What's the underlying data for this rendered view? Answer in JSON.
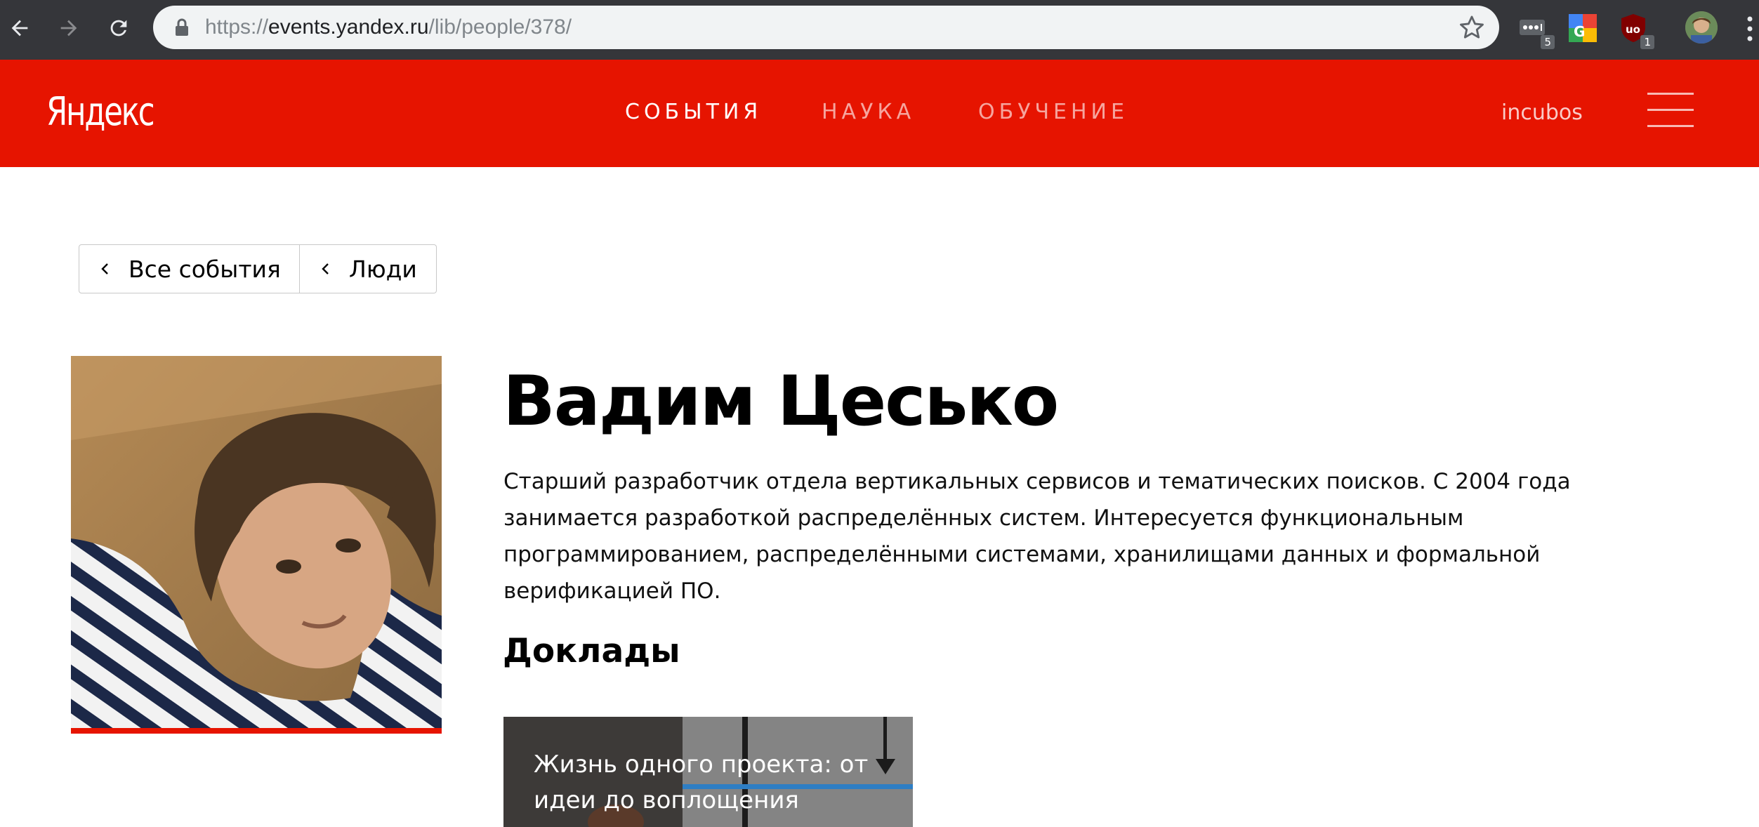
{
  "browser": {
    "url_scheme": "https://",
    "url_host": "events.yandex.ru",
    "url_path": "/lib/people/378/",
    "extensions": [
      {
        "name": "lastpass-icon",
        "badge": "5"
      },
      {
        "name": "google-translate-icon",
        "badge": ""
      },
      {
        "name": "ublock-icon",
        "badge": "1"
      }
    ]
  },
  "header": {
    "logo": "Яндекс",
    "nav": [
      {
        "label": "СОБЫТИЯ",
        "active": true
      },
      {
        "label": "НАУКА",
        "active": false
      },
      {
        "label": "ОБУЧЕНИЕ",
        "active": false
      }
    ],
    "username": "incubos",
    "accent_color": "#e61400"
  },
  "breadcrumbs": [
    {
      "label": "Все события"
    },
    {
      "label": "Люди"
    }
  ],
  "person": {
    "name": "Вадим Цесько",
    "bio": "Старший разработчик отдела вертикальных сервисов и тематических поисков. С 2004 года занимается разработкой распределённых систем. Интересуется функциональным программированием, распределёнными системами, хранилищами данных и формальной верификацией ПО."
  },
  "talks": {
    "title": "Доклады",
    "items": [
      {
        "title": "Жизнь одного проекта: от идеи до воплощения"
      }
    ]
  }
}
